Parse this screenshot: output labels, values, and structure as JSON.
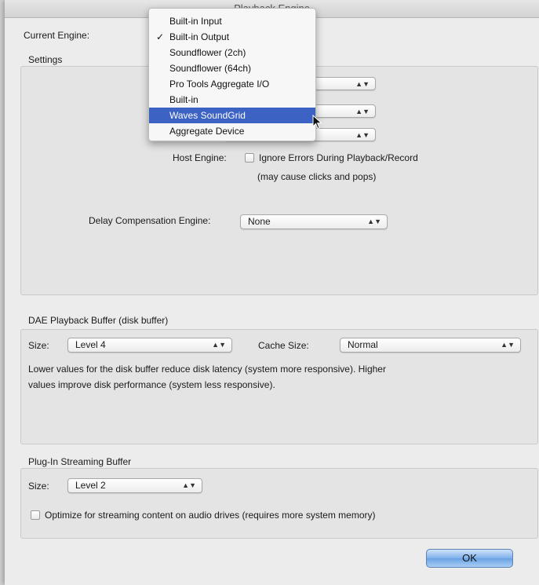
{
  "window": {
    "title": "Playback Engine"
  },
  "current_engine": {
    "label": "Current Engine:"
  },
  "settings": {
    "title": "Settings",
    "host_engine_label": "Host Engine:",
    "ignore_errors_label": "Ignore Errors During Playback/Record",
    "ignore_errors_note": "(may cause clicks and pops)",
    "delay_comp_label": "Delay Compensation Engine:",
    "delay_comp_value": "None"
  },
  "dae": {
    "title": "DAE Playback Buffer (disk buffer)",
    "size_label": "Size:",
    "size_value": "Level 4",
    "cache_label": "Cache Size:",
    "cache_value": "Normal",
    "description_line1": "Lower values for the disk buffer reduce disk latency (system more responsive).  Higher",
    "description_line2": "values improve disk performance (system less responsive)."
  },
  "plugin": {
    "title": "Plug-In Streaming Buffer",
    "size_label": "Size:",
    "size_value": "Level 2",
    "optimize_label": "Optimize for streaming content on audio drives (requires more system memory)"
  },
  "ok_label": "OK",
  "engine_menu": {
    "items": [
      {
        "label": "Built-in Input",
        "checked": false,
        "selected": false
      },
      {
        "label": "Built-in Output",
        "checked": true,
        "selected": false
      },
      {
        "label": "Soundflower (2ch)",
        "checked": false,
        "selected": false
      },
      {
        "label": "Soundflower (64ch)",
        "checked": false,
        "selected": false
      },
      {
        "label": "Pro Tools Aggregate I/O",
        "checked": false,
        "selected": false
      },
      {
        "label": "Built-in",
        "checked": false,
        "selected": false
      },
      {
        "label": "Waves SoundGrid",
        "checked": false,
        "selected": true
      },
      {
        "label": "Aggregate Device",
        "checked": false,
        "selected": false
      }
    ],
    "check_glyph": "✓"
  },
  "colors": {
    "menu_highlight": "#3c62c4",
    "ok_button": "#7fb0ea"
  }
}
